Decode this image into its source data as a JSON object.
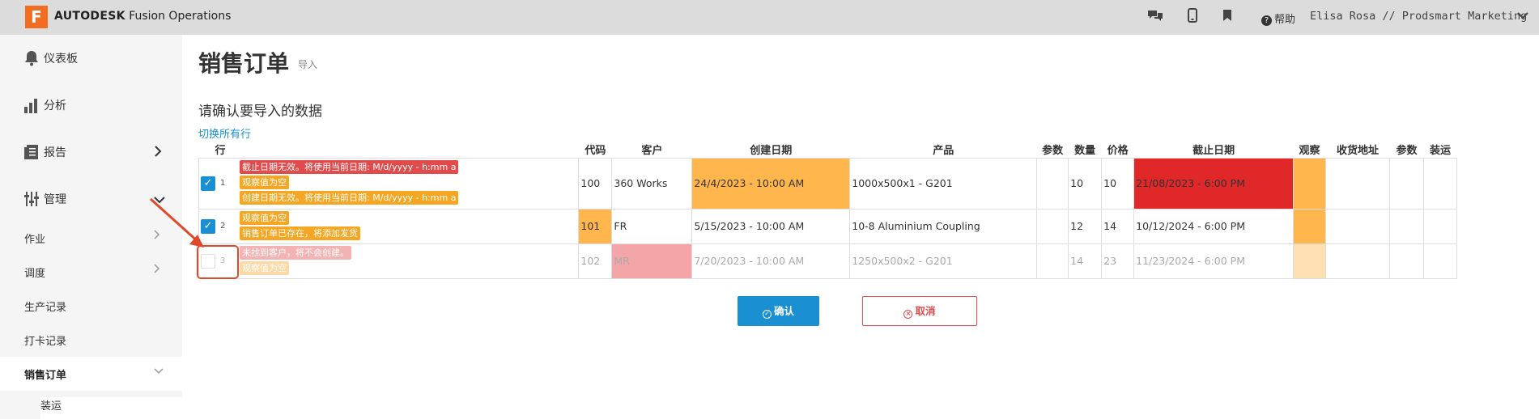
{
  "topbar": {
    "logo_letter": "F",
    "brand_bold": "AUTODESK",
    "brand_rest": " Fusion Operations",
    "help_label": "帮助",
    "user_label": "Elisa Rosa // Prodsmart Marketing"
  },
  "sidebar": {
    "dashboard": "仪表板",
    "analysis": "分析",
    "reports": "报告",
    "management": "管理",
    "jobs": "作业",
    "scheduling": "调度",
    "production_records": "生产记录",
    "clock_records": "打卡记录",
    "sales_orders": "销售订单",
    "shipping": "装运"
  },
  "main": {
    "title": "销售订单",
    "subtitle": "导入",
    "confirm_title": "请确认要导入的数据",
    "toggle_all": "切换所有行"
  },
  "table": {
    "headers": {
      "row": "行",
      "code": "代码",
      "customer": "客户",
      "created": "创建日期",
      "product": "产品",
      "param1": "参数",
      "quantity": "数量",
      "price": "价格",
      "deadline": "截止日期",
      "observe": "观察",
      "address": "收货地址",
      "param2": "参数",
      "shipping": "装运"
    },
    "rows": [
      {
        "num": "1",
        "checked": true,
        "msgs": [
          "截止日期无效。将使用当前日期: M/d/yyyy - h:mm a",
          "观察值为空",
          "创建日期无效。将使用当前日期: M/d/yyyy - h:mm a"
        ],
        "code": "100",
        "customer": "360 Works",
        "created": "24/4/2023 - 10:00 AM",
        "product": "1000x500x1 - G201",
        "param1": "",
        "quantity": "10",
        "price": "10",
        "deadline": "21/08/2023 - 6:00 PM"
      },
      {
        "num": "2",
        "checked": true,
        "msgs": [
          "观察值为空",
          "销售订单已存在，将添加发货"
        ],
        "code": "101",
        "customer": "FR",
        "created": "5/15/2023 - 10:00 AM",
        "product": "10-8 Aluminium Coupling",
        "param1": "",
        "quantity": "12",
        "price": "14",
        "deadline": "10/12/2024 - 6:00 PM"
      },
      {
        "num": "3",
        "checked": false,
        "msgs": [
          "未找到客户，将不会创建。",
          "观察值为空"
        ],
        "code": "102",
        "customer": "MR",
        "created": "7/20/2023 - 10:00 AM",
        "product": "1250x500x2 - G201",
        "param1": "",
        "quantity": "14",
        "price": "23",
        "deadline": "11/23/2024 - 6:00 PM"
      }
    ]
  },
  "buttons": {
    "confirm": "确认",
    "cancel": "取消"
  },
  "colors": {
    "accent_blue": "#1a8fd1",
    "warning_orange": "#ffb74d",
    "error_red": "#e02828",
    "annotation_red": "#e04a2a"
  }
}
